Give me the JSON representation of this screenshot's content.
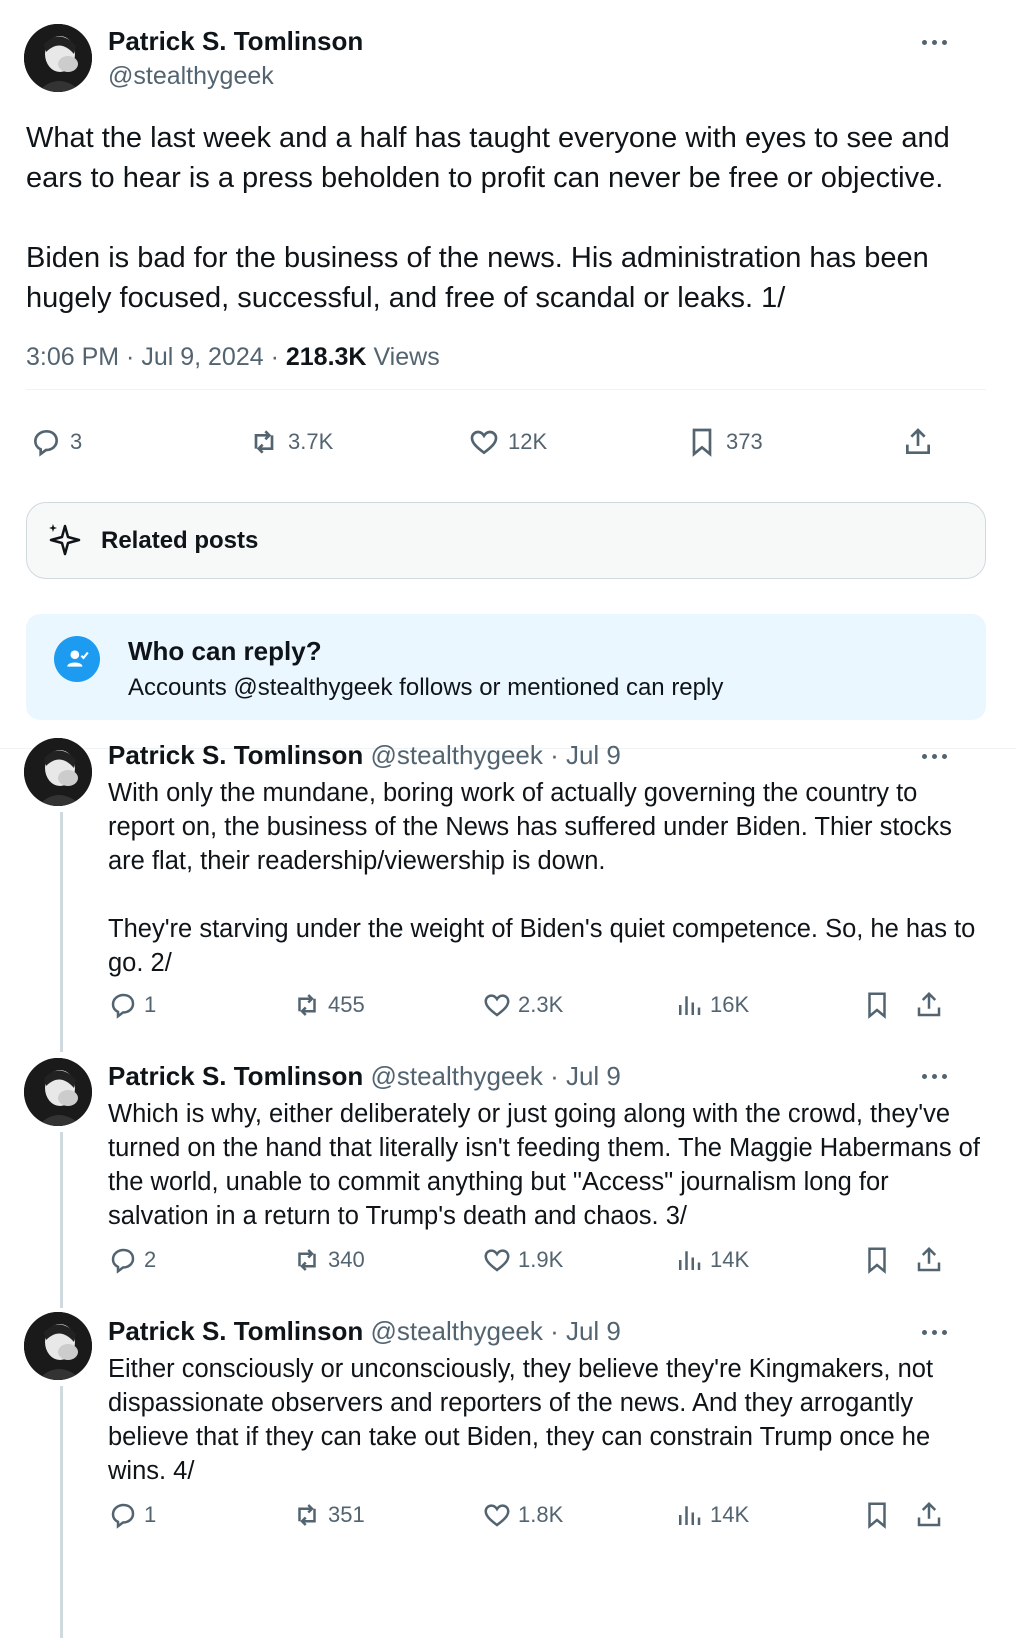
{
  "main": {
    "author_name": "Patrick S. Tomlinson",
    "author_handle": "@stealthygeek",
    "text_p1": "What the last week and a half has taught everyone with eyes to see and ears to hear is a press beholden to profit can never be free or objective.",
    "text_p2": "Biden is bad for the business of the news. His administration has been hugely focused, successful, and free of scandal or leaks. 1/",
    "time": "3:06 PM",
    "date": "Jul 9, 2024",
    "views_count": "218.3K",
    "views_label": "Views",
    "replies": "3",
    "reposts": "3.7K",
    "likes": "12K",
    "bookmarks": "373"
  },
  "related": {
    "label": "Related posts"
  },
  "who_can_reply": {
    "title": "Who can reply?",
    "subtitle": "Accounts @stealthygeek follows or mentioned can reply"
  },
  "replies": [
    {
      "name": "Patrick S. Tomlinson",
      "handle_date": "@stealthygeek · Jul 9",
      "p1": "With only the mundane, boring work of actually governing the country to report on, the business of the News has suffered under Biden. Thier stocks are flat, their readership/viewership is down.",
      "p2": "They're starving under the weight of Biden's quiet competence. So, he has to go. 2/",
      "replies": "1",
      "reposts": "455",
      "likes": "2.3K",
      "views": "16K"
    },
    {
      "name": "Patrick S. Tomlinson",
      "handle_date": "@stealthygeek · Jul 9",
      "p1": "Which is why, either deliberately or just going along with the crowd, they've turned on the hand that literally isn't feeding them. The Maggie Habermans of the world, unable to commit anything but \"Access\" journalism long for salvation in a return to Trump's death and chaos. 3/",
      "replies": "2",
      "reposts": "340",
      "likes": "1.9K",
      "views": "14K"
    },
    {
      "name": "Patrick S. Tomlinson",
      "handle_date": "@stealthygeek · Jul 9",
      "p1": "Either consciously or unconsciously, they believe they're Kingmakers, not dispassionate observers and reporters of the news. And they arrogantly believe that if they can take out Biden, they can constrain Trump once he wins. 4/",
      "replies": "1",
      "reposts": "351",
      "likes": "1.8K",
      "views": "14K"
    }
  ],
  "colors": {
    "accent": "#1d9bf0",
    "secondary_text": "#536471",
    "reply_box_bg": "#ebf7fe"
  }
}
